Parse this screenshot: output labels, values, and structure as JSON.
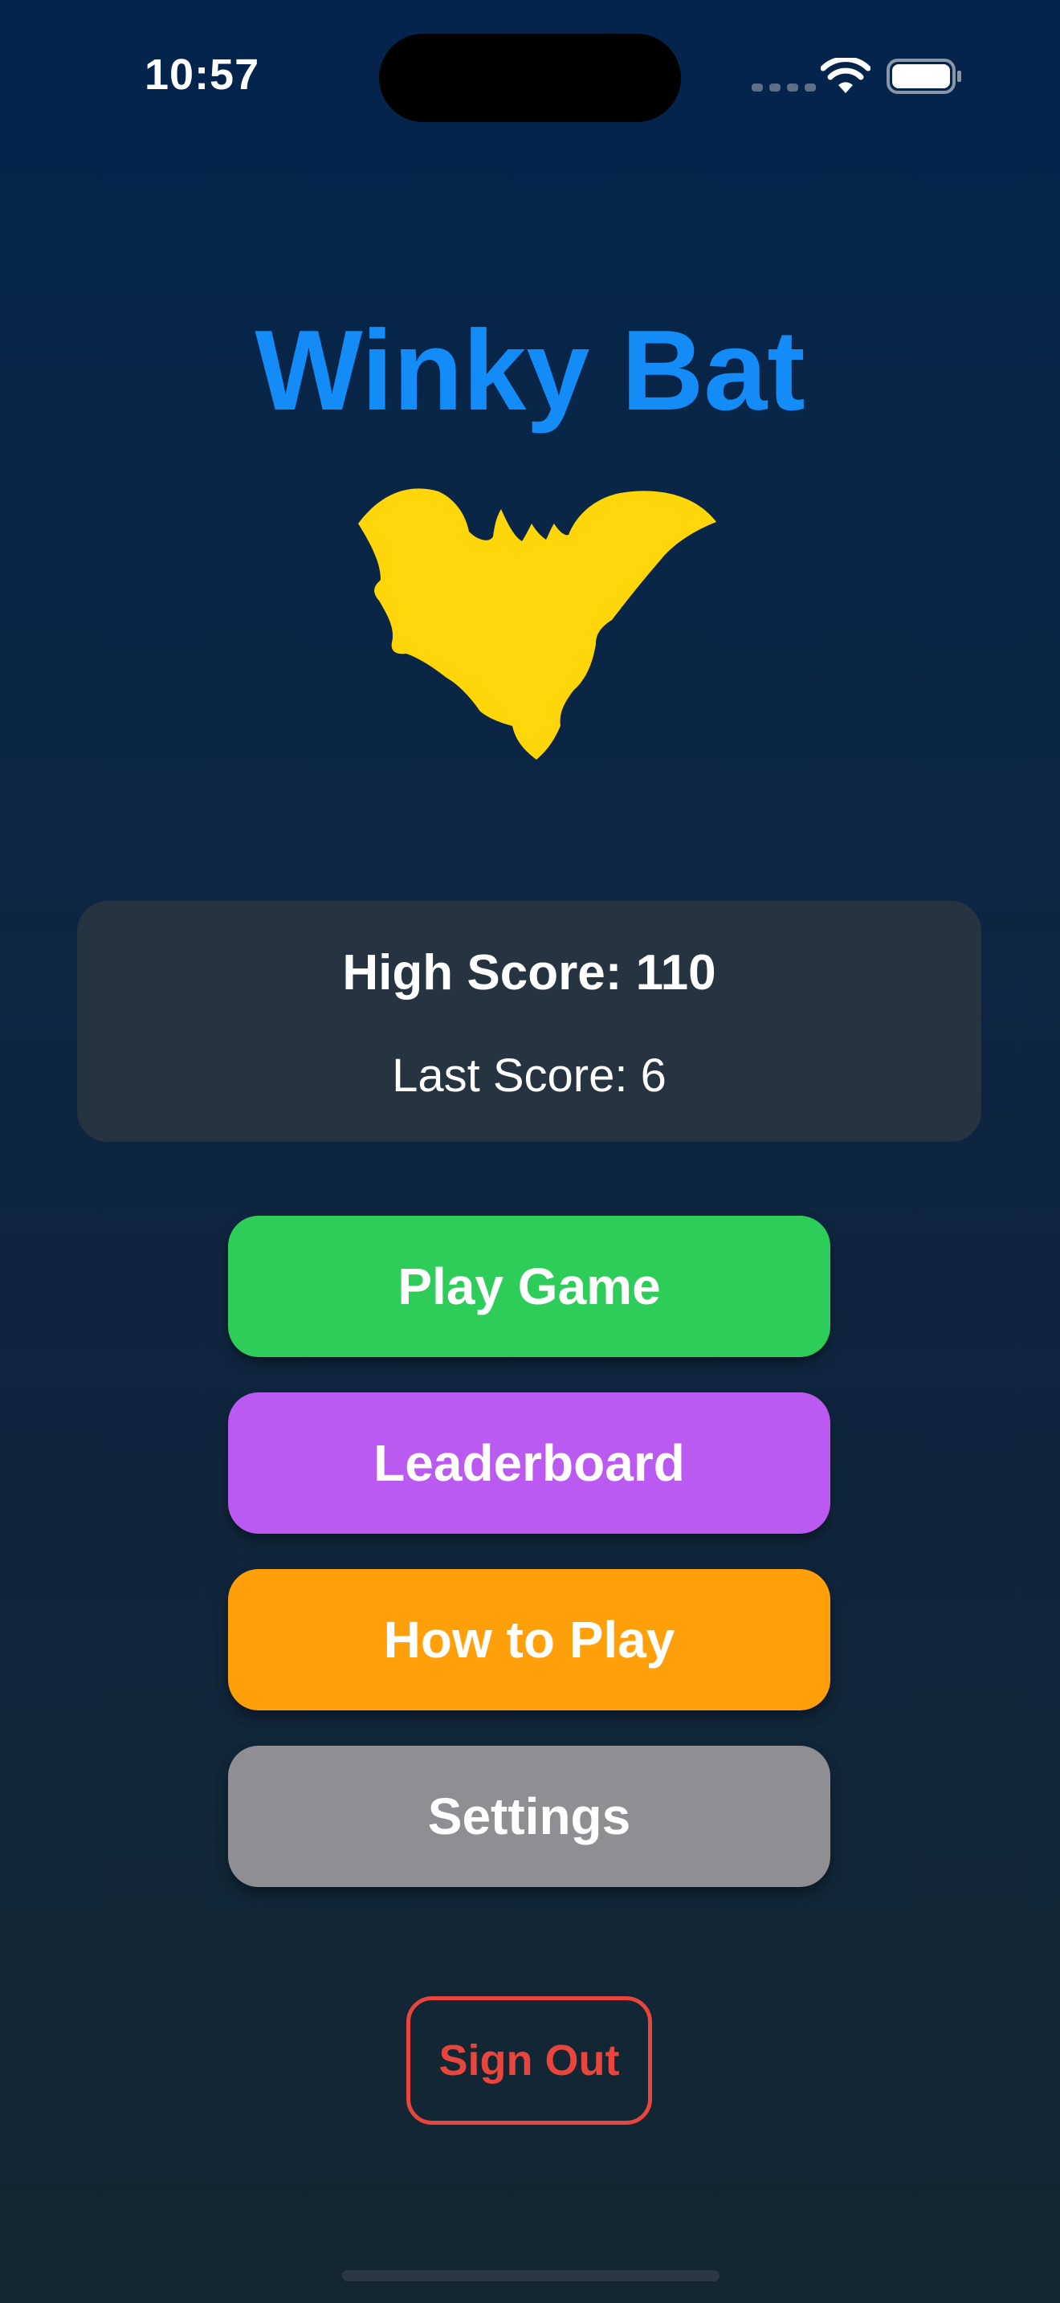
{
  "status_bar": {
    "time": "10:57",
    "icons": [
      "signal-dots-icon",
      "wifi-icon",
      "battery-icon"
    ]
  },
  "app": {
    "title": "Winky Bat",
    "title_color": "#138cf8",
    "logo_icon": "bat-icon",
    "logo_color": "#ffd60a"
  },
  "scores": {
    "high_score": "High Score: 110",
    "last_score": "Last Score: 6"
  },
  "menu": {
    "play_label": "Play Game",
    "play_color": "#2ecc59",
    "leaderboard_label": "Leaderboard",
    "leaderboard_color": "#bb5af0",
    "how_to_play_label": "How to Play",
    "how_to_play_color": "#ff9f0a",
    "settings_label": "Settings",
    "settings_color": "#8e8e93"
  },
  "account": {
    "sign_out_label": "Sign Out",
    "sign_out_color": "#e8453c"
  }
}
